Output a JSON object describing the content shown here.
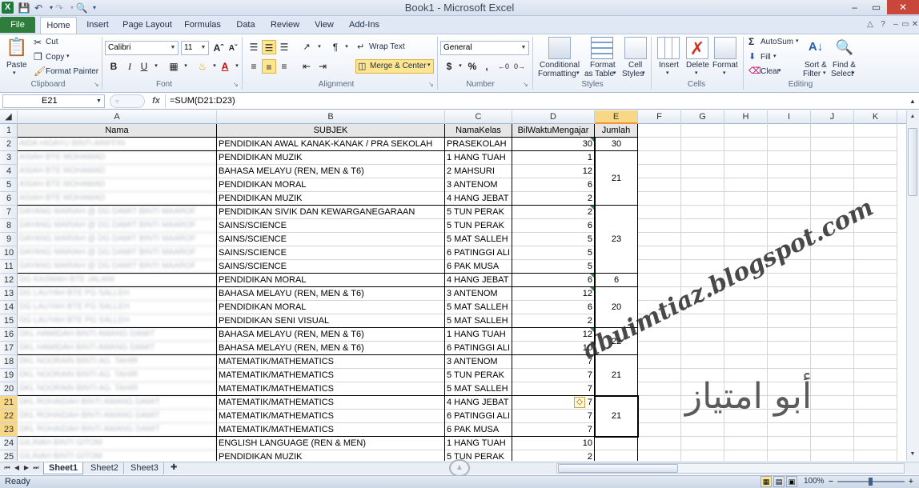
{
  "window": {
    "title": "Book1 - Microsoft Excel",
    "min": "–",
    "max": "▭",
    "close": "✕"
  },
  "tabs": [
    "File",
    "Home",
    "Insert",
    "Page Layout",
    "Formulas",
    "Data",
    "Review",
    "View",
    "Add-Ins"
  ],
  "ribbon": {
    "clipboard": {
      "label": "Clipboard",
      "paste": "Paste",
      "cut": "Cut",
      "copy": "Copy",
      "format_painter": "Format Painter"
    },
    "font": {
      "label": "Font",
      "name": "Calibri",
      "size": "11",
      "bold": "B",
      "italic": "I",
      "underline": "U"
    },
    "alignment": {
      "label": "Alignment",
      "wrap": "Wrap Text",
      "merge": "Merge & Center"
    },
    "number": {
      "label": "Number",
      "format": "General",
      "currency": "$",
      "percent": "%",
      "comma": ","
    },
    "styles": {
      "label": "Styles",
      "cond1": "Conditional",
      "cond2": "Formatting",
      "fmt1": "Format",
      "fmt2": "as Table",
      "cell1": "Cell",
      "cell2": "Styles"
    },
    "cells": {
      "label": "Cells",
      "insert": "Insert",
      "delete": "Delete",
      "format": "Format"
    },
    "editing": {
      "label": "Editing",
      "autosum": "AutoSum",
      "fill": "Fill",
      "clear": "Clear",
      "sort1": "Sort &",
      "sort2": "Filter",
      "find1": "Find &",
      "find2": "Select"
    }
  },
  "formula_bar": {
    "name_box": "E21",
    "fx": "fx",
    "formula": "=SUM(D21:D23)"
  },
  "columns": [
    "A",
    "B",
    "C",
    "D",
    "E",
    "F",
    "G",
    "H",
    "I",
    "J",
    "K"
  ],
  "header_row": {
    "a": "Nama",
    "b": "SUBJEK",
    "c": "NamaKelas",
    "d": "BilWaktuMengajar",
    "e": "Jumlah"
  },
  "rows": [
    {
      "n": "2",
      "a": "AIDA HIDAYU BINTI ARIFFIN",
      "b": "PENDIDIKAN AWAL KANAK-KANAK / PRA SEKOLAH",
      "c": "PRASEKOLAH",
      "d": "30"
    },
    {
      "n": "3",
      "a": "ASIAH BTE MOHAMAD",
      "b": "PENDIDIKAN MUZIK",
      "c": "1 HANG TUAH",
      "d": "1"
    },
    {
      "n": "4",
      "a": "ASIAH BTE MOHAMAD",
      "b": "BAHASA MELAYU (REN, MEN & T6)",
      "c": "2 MAHSURI",
      "d": "12"
    },
    {
      "n": "5",
      "a": "ASIAH BTE MOHAMAD",
      "b": "PENDIDIKAN MORAL",
      "c": "3 ANTENOM",
      "d": "6"
    },
    {
      "n": "6",
      "a": "ASIAH BTE MOHAMAD",
      "b": "PENDIDIKAN MUZIK",
      "c": "4 HANG JEBAT",
      "d": "2"
    },
    {
      "n": "7",
      "a": "DAYANG MARIAH @ DG DAMIT BINTI MAAROF",
      "b": "PENDIDIKAN SIVIK DAN KEWARGANEGARAAN",
      "c": "5 TUN PERAK",
      "d": "2"
    },
    {
      "n": "8",
      "a": "DAYANG MARIAH @ DG DAMIT BINTI MAAROF",
      "b": "SAINS/SCIENCE",
      "c": "5 TUN PERAK",
      "d": "6"
    },
    {
      "n": "9",
      "a": "DAYANG MARIAH @ DG DAMIT BINTI MAAROF",
      "b": "SAINS/SCIENCE",
      "c": "5 MAT SALLEH",
      "d": "5"
    },
    {
      "n": "10",
      "a": "DAYANG MARIAH @ DG DAMIT BINTI MAAROF",
      "b": "SAINS/SCIENCE",
      "c": "6 PATINGGI ALI",
      "d": "5"
    },
    {
      "n": "11",
      "a": "DAYANG MARIAH @ DG DAMIT BINTI MAAROF",
      "b": "SAINS/SCIENCE",
      "c": "6 PAK MUSA",
      "d": "5"
    },
    {
      "n": "12",
      "a": "DG KASMAH BTE JALANI",
      "b": "PENDIDIKAN MORAL",
      "c": "4 HANG JEBAT",
      "d": "6"
    },
    {
      "n": "13",
      "a": "DG LAUYAH BTE PG SALLEH",
      "b": "BAHASA MELAYU (REN, MEN & T6)",
      "c": "3 ANTENOM",
      "d": "12"
    },
    {
      "n": "14",
      "a": "DG LAUYAH BTE PG SALLEH",
      "b": "PENDIDIKAN MORAL",
      "c": "5 MAT SALLEH",
      "d": "6"
    },
    {
      "n": "15",
      "a": "DG LAUYAH BTE PG SALLEH",
      "b": "PENDIDIKAN SENI VISUAL",
      "c": "5 MAT SALLEH",
      "d": "2"
    },
    {
      "n": "16",
      "a": "DKL HAMIDAH BINTI AWANG DAMIT",
      "b": "BAHASA MELAYU (REN, MEN & T6)",
      "c": "1 HANG TUAH",
      "d": "12"
    },
    {
      "n": "17",
      "a": "DKL HAMIDAH BINTI AWANG DAMIT",
      "b": "BAHASA MELAYU (REN, MEN & T6)",
      "c": "6 PATINGGI ALI",
      "d": "10"
    },
    {
      "n": "18",
      "a": "DKL NOORAIN BINTI AG. TAHIR",
      "b": "MATEMATIK/MATHEMATICS",
      "c": "3 ANTENOM",
      "d": "7"
    },
    {
      "n": "19",
      "a": "DKL NOORAIN BINTI AG. TAHIR",
      "b": "MATEMATIK/MATHEMATICS",
      "c": "5 TUN PERAK",
      "d": "7"
    },
    {
      "n": "20",
      "a": "DKL NOORAIN BINTI AG. TAHIR",
      "b": "MATEMATIK/MATHEMATICS",
      "c": "5 MAT SALLEH",
      "d": "7"
    },
    {
      "n": "21",
      "a": "DKL ROHAIDAH BINTI AWANG DAMIT",
      "b": "MATEMATIK/MATHEMATICS",
      "c": "4 HANG JEBAT",
      "d": "7"
    },
    {
      "n": "22",
      "a": "DKL ROHAIDAH BINTI AWANG DAMIT",
      "b": "MATEMATIK/MATHEMATICS",
      "c": "6 PATINGGI ALI",
      "d": "7"
    },
    {
      "n": "23",
      "a": "DKL ROHAIDAH BINTI AWANG DAMIT",
      "b": "MATEMATIK/MATHEMATICS",
      "c": "6 PAK MUSA",
      "d": "7"
    },
    {
      "n": "24",
      "a": "GILINAH BINTI GITOM",
      "b": "ENGLISH LANGUAGE (REN & MEN)",
      "c": "1 HANG TUAH",
      "d": "10"
    },
    {
      "n": "25",
      "a": "GILINAH BINTI GITOM",
      "b": "PENDIDIKAN MUZIK",
      "c": "5 TUN PERAK",
      "d": "2"
    }
  ],
  "jumlah": [
    {
      "from": 2,
      "to": 2,
      "value": "30"
    },
    {
      "from": 3,
      "to": 6,
      "value": "21"
    },
    {
      "from": 7,
      "to": 11,
      "value": "23"
    },
    {
      "from": 12,
      "to": 12,
      "value": "6"
    },
    {
      "from": 13,
      "to": 15,
      "value": "20"
    },
    {
      "from": 16,
      "to": 17,
      "value": "22"
    },
    {
      "from": 18,
      "to": 20,
      "value": "21"
    },
    {
      "from": 21,
      "to": 23,
      "value": "21"
    }
  ],
  "sheets": [
    "Sheet1",
    "Sheet2",
    "Sheet3"
  ],
  "status": {
    "ready": "Ready",
    "zoom": "100%"
  },
  "watermark": {
    "text": "abuimtiaz.blogspot.com",
    "arabic": "أبو امتياز"
  }
}
